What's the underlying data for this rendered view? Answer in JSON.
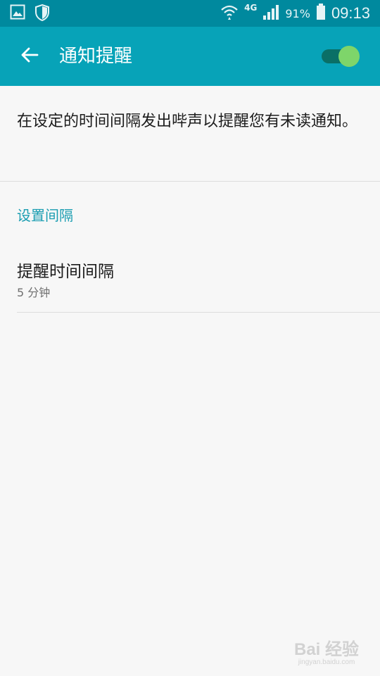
{
  "status_bar": {
    "network_type": "4G",
    "battery_percent": "91%",
    "time": "09:13",
    "icons": [
      "gallery-icon",
      "shield-icon",
      "wifi-icon",
      "signal-icon",
      "battery-icon"
    ]
  },
  "app_bar": {
    "title": "通知提醒",
    "back_icon": "arrow-left-icon",
    "toggle_on": true,
    "colors": {
      "bar": "#07a3b8",
      "status": "#00899e",
      "thumb": "#7ed56a"
    }
  },
  "description": "在设定的时间间隔发出哔声以提醒您有未读通知。",
  "section_header": "设置间隔",
  "interval_row": {
    "title": "提醒时间间隔",
    "value": "5 分钟"
  },
  "watermark": {
    "logo": "Bai 经验",
    "url": "jingyan.baidu.com"
  }
}
